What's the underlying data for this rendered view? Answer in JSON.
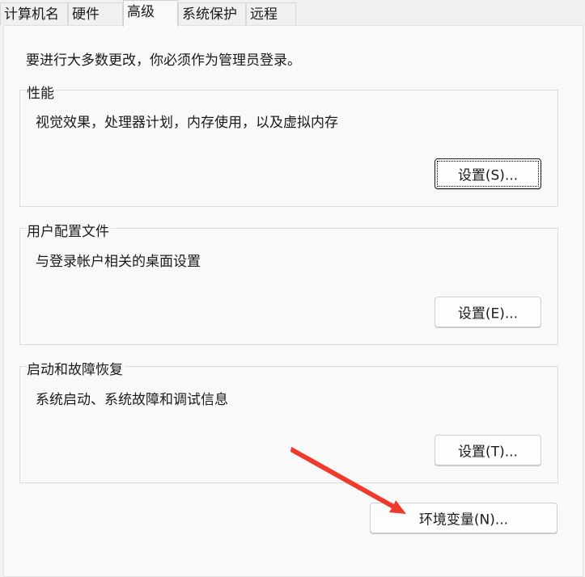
{
  "tabs": [
    {
      "label": "计算机名"
    },
    {
      "label": "硬件"
    },
    {
      "label": "高级"
    },
    {
      "label": "系统保护"
    },
    {
      "label": "远程"
    }
  ],
  "intro_text": "要进行大多数更改，你必须作为管理员登录。",
  "performance": {
    "title": "性能",
    "description": "视觉效果，处理器计划，内存使用，以及虚拟内存",
    "button": "设置(S)..."
  },
  "user_profiles": {
    "title": "用户配置文件",
    "description": "与登录帐户相关的桌面设置",
    "button": "设置(E)..."
  },
  "startup_recovery": {
    "title": "启动和故障恢复",
    "description": "系统启动、系统故障和调试信息",
    "button": "设置(T)..."
  },
  "env_button": "环境变量(N)...",
  "colors": {
    "annotation_arrow": "#f03a2e",
    "background": "#f9f9f9"
  }
}
